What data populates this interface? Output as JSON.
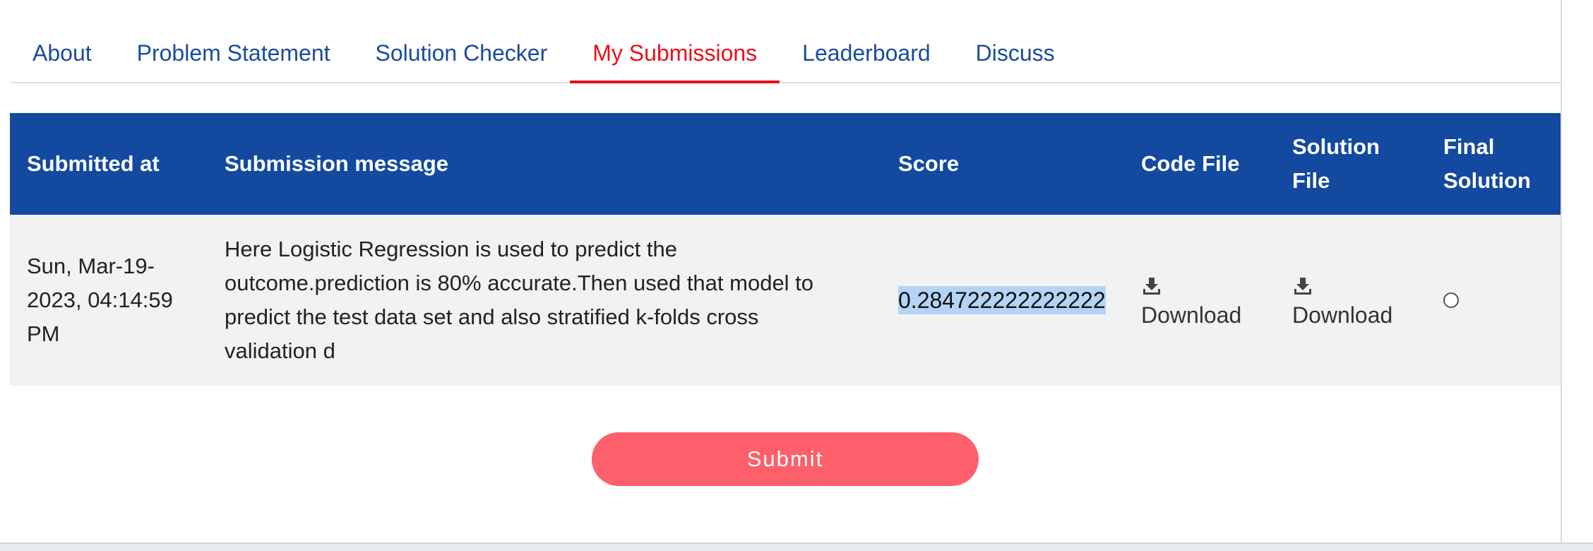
{
  "tabs": [
    {
      "label": "About"
    },
    {
      "label": "Problem Statement"
    },
    {
      "label": "Solution Checker"
    },
    {
      "label": "My Submissions"
    },
    {
      "label": "Leaderboard"
    },
    {
      "label": "Discuss"
    }
  ],
  "active_tab": "My Submissions",
  "table": {
    "headers": {
      "submitted_at": "Submitted at",
      "message": "Submission message",
      "score": "Score",
      "code_file": "Code File",
      "solution_file_1": "Solution",
      "solution_file_2": "File",
      "final_solution_1": "Final",
      "final_solution_2": "Solution"
    },
    "rows": [
      {
        "submitted_1": "Sun, Mar-19-",
        "submitted_2": "2023, 04:14:59",
        "submitted_3": "PM",
        "message_1": "Here Logistic Regression is used to predict the",
        "message_2": "outcome.prediction is 80% accurate.Then used that model to",
        "message_3": "predict the test data set and also stratified k-folds cross",
        "message_4": "validation d",
        "score": "0.284722222222222",
        "code_file_label": "Download",
        "solution_file_label": "Download",
        "code_file_icon": "download-icon",
        "solution_file_icon": "download-icon",
        "final_solution_selected": false
      }
    ]
  },
  "submit_label": "Submit",
  "colors": {
    "tab_text": "#1a4c9c",
    "tab_active": "#e8101b",
    "header_bg": "#134a9f",
    "row_bg": "#f2f2f2",
    "submit_bg": "#fd5f6b",
    "selection": "#b4d3f7"
  }
}
